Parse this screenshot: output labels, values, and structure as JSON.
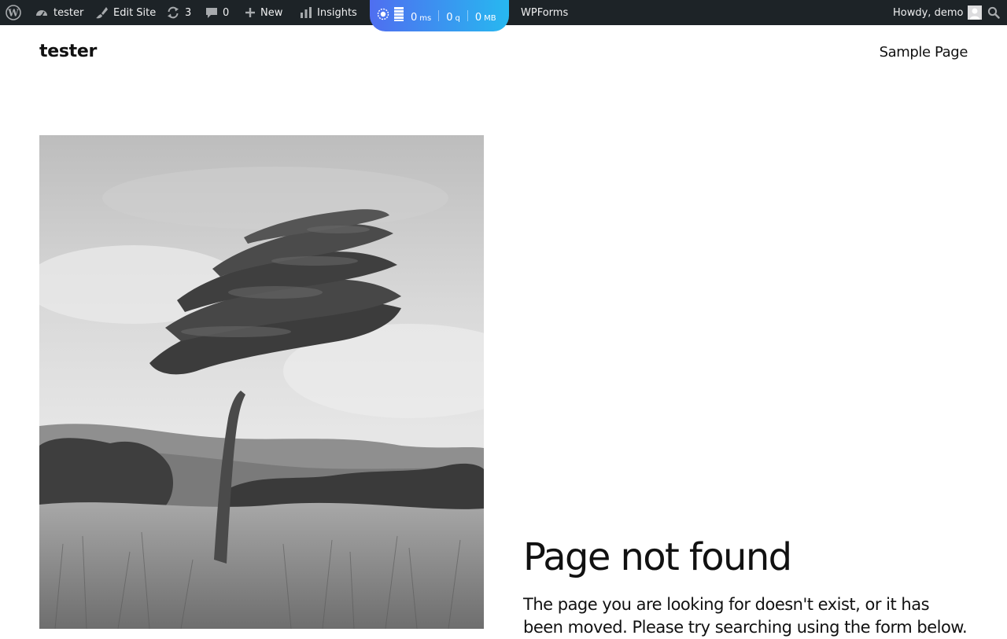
{
  "admin_bar": {
    "site_name": "tester",
    "edit_site_label": "Edit Site",
    "updates_count": "3",
    "comments_count": "0",
    "new_label": "New",
    "insights_label": "Insights",
    "wpforms_label": "WPForms",
    "greeting": "Howdy, demo",
    "query_monitor": {
      "time_value": "0",
      "time_unit": "ms",
      "queries_value": "0",
      "queries_unit": "q",
      "memory_value": "0",
      "memory_unit": "MB",
      "gradient_start": "#4f6ef0",
      "gradient_end": "#27b8f0"
    },
    "icons": [
      "wordpress-icon",
      "dashboard-icon",
      "brush-icon",
      "refresh-icon",
      "comment-icon",
      "plus-icon",
      "bar-chart-icon",
      "user-avatar-icon",
      "search-icon"
    ],
    "background_color": "#1d2327"
  },
  "header": {
    "site_title": "tester",
    "nav": [
      "Sample Page"
    ]
  },
  "content": {
    "hero_image": "black-and-white windswept tree on grassy hillside",
    "title": "Page not found",
    "description": "The page you are looking for doesn't exist, or it has been moved. Please try searching using the form below."
  }
}
